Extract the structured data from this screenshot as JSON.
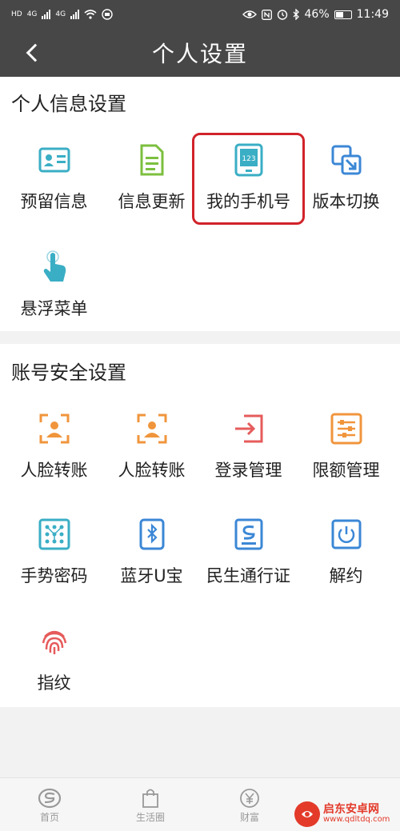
{
  "status_bar": {
    "carrier1": "HD",
    "net1": "4G",
    "net2": "4G",
    "battery_percent": "46%",
    "time": "11:49"
  },
  "header": {
    "title": "个人设置",
    "back_icon": "chevron-left-icon"
  },
  "personal_section": {
    "title": "个人信息设置",
    "items": [
      {
        "label": "预留信息",
        "icon": "id-card-icon",
        "color": "#3aaec5"
      },
      {
        "label": "信息更新",
        "icon": "document-icon",
        "color": "#7cbf3e"
      },
      {
        "label": "我的手机号",
        "icon": "phone-123-icon",
        "color": "#3aaec5",
        "highlighted": true
      },
      {
        "label": "版本切换",
        "icon": "switch-icon",
        "color": "#3b87d6"
      },
      {
        "label": "悬浮菜单",
        "icon": "hand-pointer-icon",
        "color": "#3aaec5"
      }
    ]
  },
  "security_section": {
    "title": "账号安全设置",
    "items": [
      {
        "label": "人脸转账",
        "icon": "face-scan-icon",
        "color": "#f0953c"
      },
      {
        "label": "人脸转账",
        "icon": "face-scan-icon",
        "color": "#f0953c"
      },
      {
        "label": "登录管理",
        "icon": "login-icon",
        "color": "#e65b5b"
      },
      {
        "label": "限额管理",
        "icon": "sliders-icon",
        "color": "#f0953c"
      },
      {
        "label": "手势密码",
        "icon": "gesture-grid-icon",
        "color": "#3aaec5"
      },
      {
        "label": "蓝牙U宝",
        "icon": "bluetooth-key-icon",
        "color": "#3b87d6"
      },
      {
        "label": "民生通行证",
        "icon": "passport-icon",
        "color": "#3b87d6"
      },
      {
        "label": "解约",
        "icon": "power-icon",
        "color": "#3b87d6"
      },
      {
        "label": "指纹",
        "icon": "fingerprint-icon",
        "color": "#e65b5b"
      }
    ]
  },
  "tab_bar": {
    "tabs": [
      {
        "label": "首页",
        "icon": "home-logo-icon"
      },
      {
        "label": "生活圈",
        "icon": "shopping-bag-icon"
      },
      {
        "label": "财富",
        "icon": "yen-icon"
      }
    ]
  },
  "watermark": {
    "line1": "启东安卓网",
    "line2": "www.qdltdq.com"
  }
}
